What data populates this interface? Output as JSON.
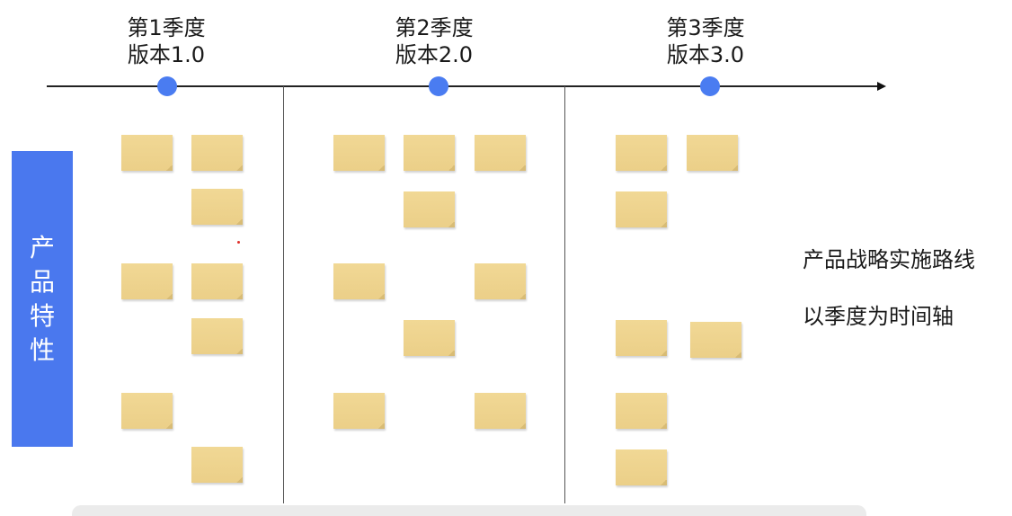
{
  "quarters": [
    {
      "quarter": "第1季度",
      "version": "版本1.0"
    },
    {
      "quarter": "第2季度",
      "version": "版本2.0"
    },
    {
      "quarter": "第3季度",
      "version": "版本3.0"
    }
  ],
  "side_label": "产品特性",
  "description": {
    "line1": "产品战略实施路线",
    "line2": "以季度为时间轴"
  },
  "colors": {
    "milestone": "#4a7cf1",
    "side_bar": "#4a78ee",
    "sticky_note": "#efd58f"
  }
}
